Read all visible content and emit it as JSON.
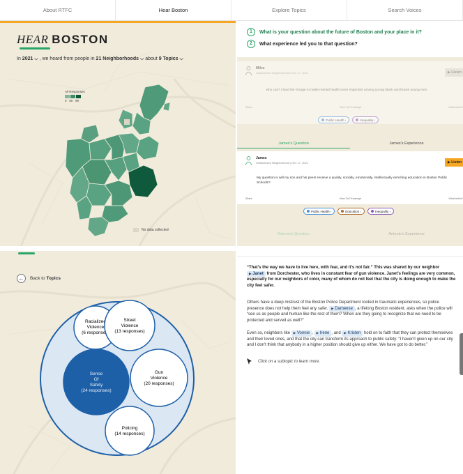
{
  "nav": {
    "tabs": [
      {
        "label": "About RTFC",
        "active": false
      },
      {
        "label": "Hear Boston",
        "active": true
      },
      {
        "label": "Explore Topics",
        "active": false
      },
      {
        "label": "Search Voices",
        "active": false
      }
    ]
  },
  "colors": {
    "accent": "#f5a623",
    "green": "#2aa568",
    "map_dark": "#0f5a3c",
    "map_mid": "#4f9a78",
    "bubble_dark": "#1e60a8"
  },
  "brand": {
    "italic": "HEAR",
    "bold": "BOSTON"
  },
  "filters": {
    "prefix": "In",
    "year": "2021",
    "middle": ", we heard from people in",
    "neighborhoods": "21 Neighborhoods",
    "about": "about",
    "topics": "9 Topics"
  },
  "legend": {
    "title": "All Responses",
    "ticks": "0   50   99"
  },
  "map": {
    "no_data": "No data collected"
  },
  "questions": [
    {
      "num": "1",
      "text": "What is your question about the future of Boston and your place in it?"
    },
    {
      "num": "2",
      "text": "What experience led you to that question?"
    }
  ],
  "card1": {
    "name": "Miles",
    "meta": "Undisclosed Neighborhood | Dec 17, 2021",
    "listen": "▶ Listen",
    "quote": "why can't I lead the charge to make mental health more important among young black and brown young men",
    "share": "Share",
    "transcript": "View Full Transcript",
    "what": "What is this?",
    "chips": [
      "Public Health ›",
      "Inequality ›"
    ]
  },
  "tabs_a": {
    "question": "James's Question",
    "experience": "James's Experience"
  },
  "card2": {
    "name": "James",
    "meta": "Undisclosed Neighborhood | Dec 17, 2021",
    "listen": "▶ Listen",
    "quote": "My question is will my son and his peers receive a quality, socially, emotionally, intellectually enriching education in Boston Public Schools?",
    "share": "Share",
    "transcript": "View Full Transcript",
    "what": "What is this?",
    "chips": [
      "Public Health ›",
      "Education ›",
      "Inequality ›"
    ]
  },
  "tabs_b": {
    "question": "Antonio's Question",
    "experience": "Antonio's Experience"
  },
  "back": {
    "prefix": "Back to",
    "bold": "Topics"
  },
  "bubbles": {
    "racialized": {
      "l1": "Racialized",
      "l2": "Violence",
      "l3": "(6 responses)"
    },
    "street": {
      "l1": "Street",
      "l2": "Violence",
      "l3": "(13 responses)"
    },
    "safety": {
      "l1": "Sense",
      "l2": "Of",
      "l3": "Safety",
      "l4": "(24 responses)"
    },
    "gun": {
      "l1": "Gun",
      "l2": "Violence",
      "l3": "(20 responses)"
    },
    "policing": {
      "l1": "Policing",
      "l2": "(14 responses)"
    }
  },
  "story": {
    "p1a": "“That's the way we have to live here, with fear, and it's not fair.” This was shared by our neighbor",
    "p1n": "Janet",
    "p1b": "from Dorchester, who lives in constant fear of gun violence. Janet's feelings are very common, especially for our neighbors of color, many of whom do not feel that the city is doing enough to make the city feel safer.",
    "p2a": "Others have a deep mistrust of the Boston Police Department rooted in traumatic experiences, so police presence does not help them feel any safer.",
    "p2n": "Dameese",
    "p2b": ", a lifelong Boston resident, asks when the police will “see us as people and human like the rest of them? When are they going to recognize that we need to be protected and served as well?”",
    "p3a": "Even so, neighbors like",
    "p3n1": "Vonnie",
    "p3n2": "Irene",
    "p3and": ", and",
    "p3n3": "Kristen",
    "p3b": "hold on to faith that they can protect themselves and their loved ones, and that the city can transform its approach to public safety: “I haven't given up on our city and I don't think that anybody in a higher position should give up either. We have got to do better.”",
    "hint": "Click on a subtopic to learn more."
  }
}
